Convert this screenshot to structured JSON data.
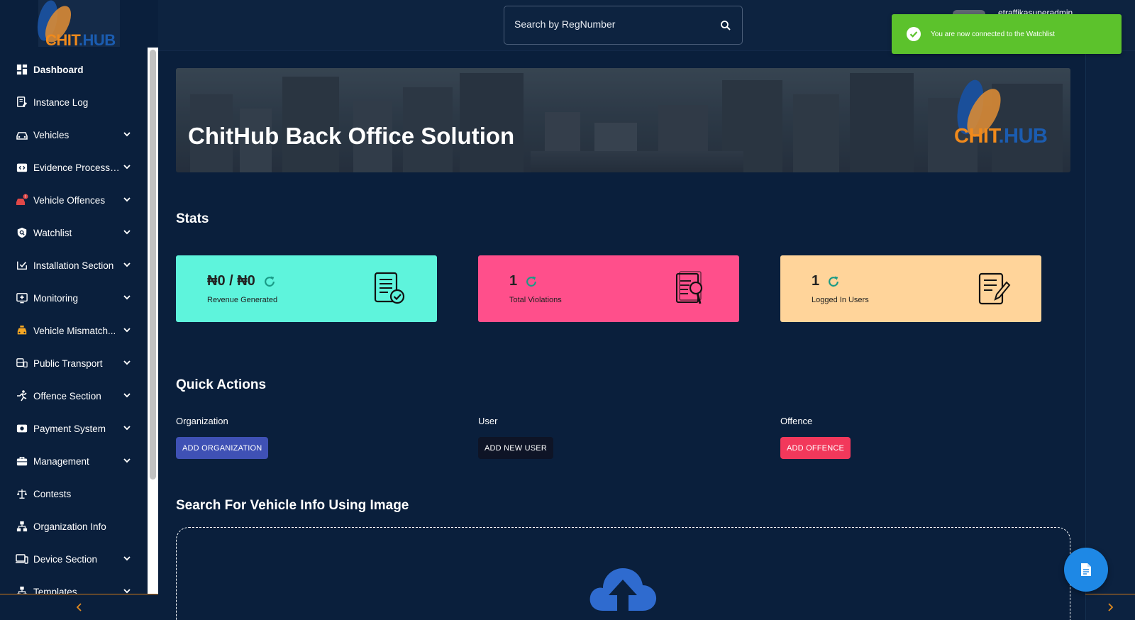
{
  "brand": {
    "logo_part1": "CHIT",
    "logo_part2": ".HUB",
    "orange": "#f08a1c",
    "blue": "#1b5cb0"
  },
  "sidebar": {
    "items": [
      {
        "label": "Dashboard",
        "icon": "dashboard-icon",
        "active": true,
        "expandable": false
      },
      {
        "label": "Instance Log",
        "icon": "log-icon",
        "active": false,
        "expandable": false
      },
      {
        "label": "Vehicles",
        "icon": "car-icon",
        "active": false,
        "expandable": true
      },
      {
        "label": "Evidence Processi...",
        "icon": "evidence-icon",
        "active": false,
        "expandable": true
      },
      {
        "label": "Vehicle Offences",
        "icon": "car-offence-icon",
        "active": false,
        "expandable": true
      },
      {
        "label": "Watchlist",
        "icon": "shield-search-icon",
        "active": false,
        "expandable": true
      },
      {
        "label": "Installation Section",
        "icon": "install-icon",
        "active": false,
        "expandable": true
      },
      {
        "label": "Monitoring",
        "icon": "monitor-icon",
        "active": false,
        "expandable": true
      },
      {
        "label": "Vehicle Mismatch...",
        "icon": "taxi-icon",
        "active": false,
        "expandable": true
      },
      {
        "label": "Public Transport",
        "icon": "bus-icon",
        "active": false,
        "expandable": true
      },
      {
        "label": "Offence Section",
        "icon": "running-icon",
        "active": false,
        "expandable": true
      },
      {
        "label": "Payment System",
        "icon": "payment-icon",
        "active": false,
        "expandable": true
      },
      {
        "label": "Management",
        "icon": "briefcase-icon",
        "active": false,
        "expandable": true
      },
      {
        "label": "Contests",
        "icon": "scale-icon",
        "active": false,
        "expandable": false
      },
      {
        "label": "Organization Info",
        "icon": "org-icon",
        "active": false,
        "expandable": false
      },
      {
        "label": "Device Section",
        "icon": "devices-icon",
        "active": false,
        "expandable": true
      },
      {
        "label": "Templates",
        "icon": "template-icon",
        "active": false,
        "expandable": true
      }
    ]
  },
  "header": {
    "search_placeholder": "Search by RegNumber",
    "username": "etraffikasuperadmin"
  },
  "toast": {
    "message": "You are now connected to the Watchlist",
    "color": "#5cc22c"
  },
  "banner": {
    "title": "ChitHub Back Office Solution"
  },
  "stats": {
    "title": "Stats",
    "cards": [
      {
        "value": "₦0 / ₦0",
        "label": "Revenue Generated",
        "color": "#5ef4dc",
        "icon": "document-check-icon"
      },
      {
        "value": "1",
        "label": "Total Violations",
        "color": "#ff4f8b",
        "icon": "document-search-icon"
      },
      {
        "value": "1",
        "label": "Logged In Users",
        "color": "#ffd49a",
        "icon": "document-edit-icon"
      }
    ]
  },
  "quick_actions": {
    "title": "Quick Actions",
    "groups": [
      {
        "label": "Organization",
        "button": "ADD ORGANIZATION",
        "color": "#3f51b5"
      },
      {
        "label": "User",
        "button": "ADD NEW USER",
        "color": "#0e1426"
      },
      {
        "label": "Offence",
        "button": "ADD OFFENCE",
        "color": "#f2385b"
      }
    ]
  },
  "image_search": {
    "title": "Search For Vehicle Info Using Image"
  }
}
